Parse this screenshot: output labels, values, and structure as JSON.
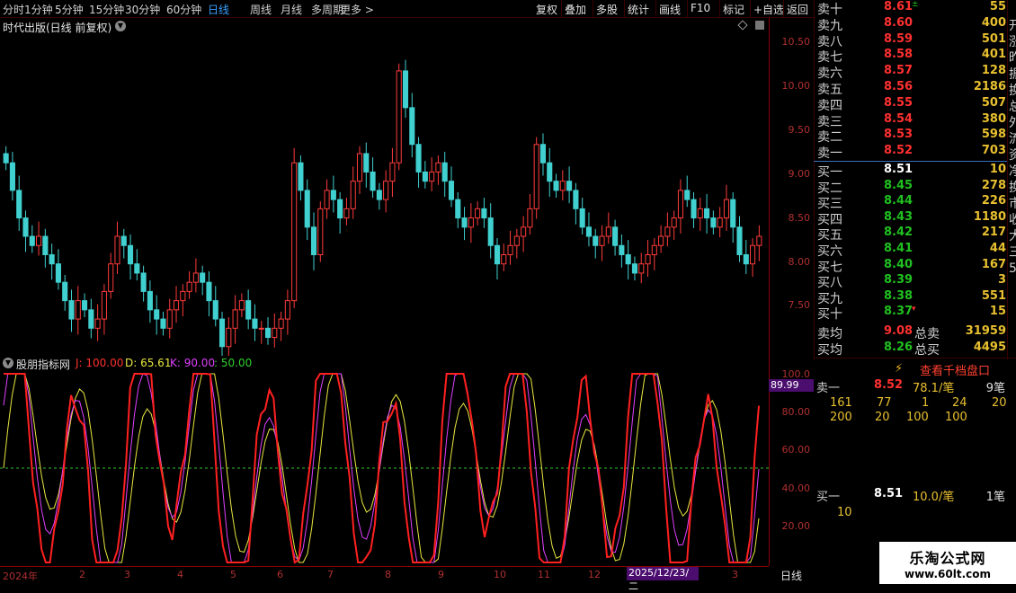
{
  "toolbar": {
    "tabs": [
      "分时",
      "1分钟",
      "5分钟",
      "15分钟",
      "30分钟",
      "60分钟",
      "日线",
      "周线",
      "月线",
      "多周期",
      "更多 >"
    ],
    "active_tab": "日线",
    "right_buttons": [
      "复权",
      "叠加",
      "多股",
      "统计",
      "画线",
      "F10",
      "标记",
      "+自选",
      "返回"
    ]
  },
  "chart": {
    "title": "时代出版(日线 前复权)",
    "price_axis": [
      "10.50",
      "10.00",
      "9.50",
      "9.00",
      "8.50",
      "8.00",
      "7.50"
    ],
    "period_label": "日线"
  },
  "indicator": {
    "name": "股朋指标网",
    "j_label": "J: 100.00",
    "d_label": "D: 65.61",
    "k_label": "K: 90.00",
    "level_label": ": 50.00",
    "axis": [
      "100.0",
      "80.00",
      "60.00",
      "40.00",
      "20.00"
    ],
    "current_value": "89.99"
  },
  "dates": {
    "labels": [
      "2024年",
      "2",
      "3",
      "4",
      "5",
      "6",
      "7",
      "8",
      "9",
      "10",
      "11",
      "12",
      "2025/12/23/二",
      "3"
    ],
    "highlight": "2025/12/23/二"
  },
  "order_book": {
    "asks": [
      {
        "label": "卖十",
        "price": "8.61",
        "vol": "55",
        "mark": "±"
      },
      {
        "label": "卖九",
        "price": "8.60",
        "vol": "400"
      },
      {
        "label": "卖八",
        "price": "8.59",
        "vol": "501"
      },
      {
        "label": "卖七",
        "price": "8.58",
        "vol": "401"
      },
      {
        "label": "卖六",
        "price": "8.57",
        "vol": "128"
      },
      {
        "label": "卖五",
        "price": "8.56",
        "vol": "2186"
      },
      {
        "label": "卖四",
        "price": "8.55",
        "vol": "507"
      },
      {
        "label": "卖三",
        "price": "8.54",
        "vol": "380"
      },
      {
        "label": "卖二",
        "price": "8.53",
        "vol": "598"
      },
      {
        "label": "卖一",
        "price": "8.52",
        "vol": "703"
      }
    ],
    "bids": [
      {
        "label": "买一",
        "price": "8.51",
        "vol": "10"
      },
      {
        "label": "买二",
        "price": "8.45",
        "vol": "278"
      },
      {
        "label": "买三",
        "price": "8.44",
        "vol": "226"
      },
      {
        "label": "买四",
        "price": "8.43",
        "vol": "1180"
      },
      {
        "label": "买五",
        "price": "8.42",
        "vol": "217"
      },
      {
        "label": "买六",
        "price": "8.41",
        "vol": "44"
      },
      {
        "label": "买七",
        "price": "8.40",
        "vol": "167"
      },
      {
        "label": "买八",
        "price": "8.39",
        "vol": "3"
      },
      {
        "label": "买九",
        "price": "8.38",
        "vol": "551"
      },
      {
        "label": "买十",
        "price": "8.37",
        "vol": "15",
        "mark": "▾"
      }
    ],
    "avg_sell": {
      "label": "卖均",
      "price": "9.08",
      "total_label": "总卖",
      "total": "31959"
    },
    "avg_buy": {
      "label": "买均",
      "price": "8.26",
      "total_label": "总买",
      "total": "4495"
    },
    "edge_chars": [
      "开",
      "涨",
      "昨",
      "振",
      "换",
      "总",
      "外",
      "流",
      "资",
      "净",
      "换",
      "市",
      "收",
      "大",
      "三",
      "5"
    ]
  },
  "depth": {
    "view_button": "查看千档盘口",
    "ask1": {
      "label": "卖一",
      "price": "8.52",
      "avg": "78.1/笔",
      "count": "9笔"
    },
    "ask_orders_row1": [
      "161",
      "77",
      "1",
      "24",
      "20"
    ],
    "ask_orders_row2": [
      "200",
      "20",
      "100",
      "100"
    ],
    "bid1": {
      "label": "买一",
      "price": "8.51",
      "avg": "10.0/笔",
      "count": "1笔"
    },
    "bid_orders_row1": [
      "10"
    ]
  },
  "watermark": {
    "line1": "乐淘公式网",
    "line2": "www.60lt.com"
  },
  "chart_data": {
    "type": "candlestick",
    "price_range": [
      7.2,
      10.7
    ],
    "closes": [
      9.3,
      9.0,
      8.7,
      8.5,
      8.4,
      8.5,
      8.3,
      8.2,
      8.0,
      7.8,
      7.6,
      7.8,
      7.7,
      7.5,
      7.6,
      7.9,
      8.2,
      8.5,
      8.4,
      8.2,
      8.1,
      7.9,
      7.7,
      7.6,
      7.5,
      7.7,
      7.8,
      7.9,
      8.0,
      8.1,
      8.0,
      7.8,
      7.6,
      7.3,
      7.5,
      7.7,
      7.8,
      7.6,
      7.5,
      7.5,
      7.4,
      7.5,
      7.6,
      7.8,
      9.3,
      9.0,
      8.6,
      8.3,
      8.8,
      9.0,
      8.9,
      8.7,
      8.8,
      9.1,
      9.4,
      9.2,
      9.0,
      8.9,
      9.1,
      9.3,
      10.3,
      9.9,
      9.5,
      9.2,
      9.1,
      9.2,
      9.3,
      9.1,
      8.9,
      8.7,
      8.6,
      8.7,
      8.8,
      8.7,
      8.4,
      8.2,
      8.3,
      8.4,
      8.5,
      8.6,
      8.8,
      9.5,
      9.3,
      9.1,
      9.0,
      9.1,
      9.0,
      8.8,
      8.6,
      8.5,
      8.4,
      8.5,
      8.6,
      8.4,
      8.3,
      8.2,
      8.1,
      8.2,
      8.3,
      8.4,
      8.5,
      8.6,
      8.7,
      9.0,
      8.9,
      8.7,
      8.8,
      8.7,
      8.6,
      8.7,
      8.9,
      8.6,
      8.3,
      8.2,
      8.4,
      8.5
    ]
  }
}
